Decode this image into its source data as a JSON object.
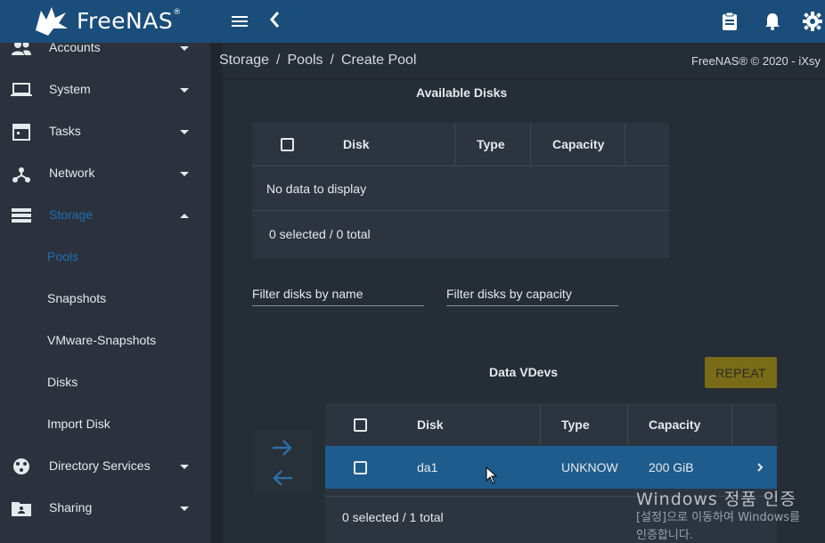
{
  "app": {
    "logo_text": "FreeNAS",
    "logo_mark": "®"
  },
  "topbar": {
    "menu_icon": "hamburger-icon",
    "back_icon": "chevron-left-icon",
    "icons": [
      "clipboard-icon",
      "bell-icon",
      "gear-icon"
    ]
  },
  "sidebar": {
    "items": [
      {
        "label": "Accounts",
        "icon": "people-icon"
      },
      {
        "label": "System",
        "icon": "laptop-icon"
      },
      {
        "label": "Tasks",
        "icon": "calendar-icon"
      },
      {
        "label": "Network",
        "icon": "network-icon"
      },
      {
        "label": "Storage",
        "icon": "storage-icon"
      },
      {
        "label": "Directory Services",
        "icon": "directory-icon"
      },
      {
        "label": "Sharing",
        "icon": "folder-share-icon"
      }
    ],
    "storage_sub": [
      {
        "label": "Pools"
      },
      {
        "label": "Snapshots"
      },
      {
        "label": "VMware-Snapshots"
      },
      {
        "label": "Disks"
      },
      {
        "label": "Import Disk"
      }
    ]
  },
  "breadcrumb": {
    "items": [
      "Storage",
      "Pools",
      "Create Pool"
    ],
    "separator": "/"
  },
  "copyright": "FreeNAS® © 2020 - iXsy",
  "available_disks": {
    "title": "Available Disks",
    "columns": [
      "Disk",
      "Type",
      "Capacity"
    ],
    "empty_message": "No data to display",
    "footer": "0 selected / 0 total"
  },
  "filters": {
    "by_name": "Filter disks by name",
    "by_capacity": "Filter disks by capacity"
  },
  "data_vdevs": {
    "title": "Data VDevs",
    "repeat_label": "REPEAT",
    "columns": [
      "Disk",
      "Type",
      "Capacity"
    ],
    "rows": [
      {
        "disk": "da1",
        "type": "UNKNOW",
        "capacity": "200 GiB"
      }
    ],
    "footer": "0 selected / 1 total"
  },
  "watermark": {
    "line1": "Windows 정품 인증",
    "line2": "[설정]으로 이동하여 Windows를",
    "line3": "인증합니다."
  },
  "colors": {
    "topbar": "#1b4d7a",
    "sidebar": "#2b323d",
    "content": "#252d37",
    "active": "#1e6fb4",
    "repeat_button": "#7a6b17",
    "selected_row": "#1e5c8d"
  }
}
